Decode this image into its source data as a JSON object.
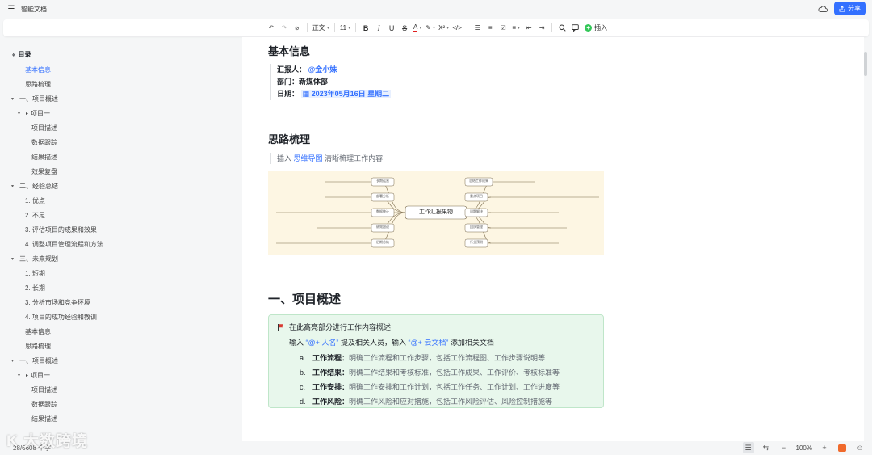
{
  "titlebar": {
    "doc_title": "智能文档",
    "share_label": "分享"
  },
  "toolbar": {
    "paragraph_style": "正文",
    "font_size": "11",
    "superscript": "X²",
    "code": "</>",
    "insert_label": "插入"
  },
  "outline": {
    "title": "目录",
    "items": [
      {
        "label": "基本信息"
      },
      {
        "label": "思路梳理"
      },
      {
        "label": "一、项目概述"
      },
      {
        "label": "项目一"
      },
      {
        "label": "项目描述"
      },
      {
        "label": "数据跟踪"
      },
      {
        "label": "结果描述"
      },
      {
        "label": "效果复盘"
      },
      {
        "label": "二、经验总结"
      },
      {
        "label": "1. 优点"
      },
      {
        "label": "2. 不足"
      },
      {
        "label": "3. 评估项目的成果和效果"
      },
      {
        "label": "4. 调整项目管理流程和方法"
      },
      {
        "label": "三、未来规划"
      },
      {
        "label": "1. 短期"
      },
      {
        "label": "2. 长期"
      },
      {
        "label": "3. 分析市场和竞争环境"
      },
      {
        "label": "4. 项目的成功经验和教训"
      },
      {
        "label": "基本信息"
      },
      {
        "label": "思路梳理"
      },
      {
        "label": "一、项目概述"
      },
      {
        "label": "项目一"
      },
      {
        "label": "项目描述"
      },
      {
        "label": "数据跟踪"
      },
      {
        "label": "结果描述"
      }
    ]
  },
  "doc": {
    "basic_info_title": "基本信息",
    "reporter_label": "汇报人：",
    "reporter_value": "@金小妹",
    "dept_label": "部门：",
    "dept_value": "新媒体部",
    "date_label": "日期：",
    "date_value": "2023年05月16日 星期二",
    "thinking_title": "思路梳理",
    "thinking_prefix": "插入",
    "thinking_link": "思维导图",
    "thinking_suffix": "清晰梳理工作内容",
    "mindmap": {
      "center": "工作汇报果物",
      "left": [
        "长期运营",
        "部署分析",
        "数据统计",
        "绩效跟进",
        "后期总结"
      ],
      "right": [
        "总结工作成果",
        "重点项目",
        "问题解决",
        "团队管理",
        "行业预测"
      ]
    },
    "section1_title": "一、项目概述",
    "callout": {
      "head": "在此高亮部分进行工作内容概述",
      "sub_prefix": "输入",
      "sub_mention1": "“@+ 人名”",
      "sub_mid": "提及相关人员，输入",
      "sub_mention2": "“@+ 云文档”",
      "sub_suffix": "添加相关文档",
      "items": [
        {
          "num": "a.",
          "label": "工作流程：",
          "text": "明确工作流程和工作步骤，包括工作流程图、工作步骤说明等"
        },
        {
          "num": "b.",
          "label": "工作结果：",
          "text": "明确工作结果和考核标准，包括工作成果、工作评价、考核标准等"
        },
        {
          "num": "c.",
          "label": "工作安排：",
          "text": "明确工作安排和工作计划，包括工作任务、工作计划、工作进度等"
        },
        {
          "num": "d.",
          "label": "工作风险：",
          "text": "明确工作风险和应对措施，包括工作风险评估、风险控制措施等"
        }
      ]
    }
  },
  "status": {
    "word_count": "28/6608 个字",
    "zoom": "100%",
    "watermark": "K 大数跨境"
  },
  "colors": {
    "accent": "#3370ff",
    "callout_bg": "#e8f7ec",
    "mindmap_bg": "#fdf6e3"
  }
}
